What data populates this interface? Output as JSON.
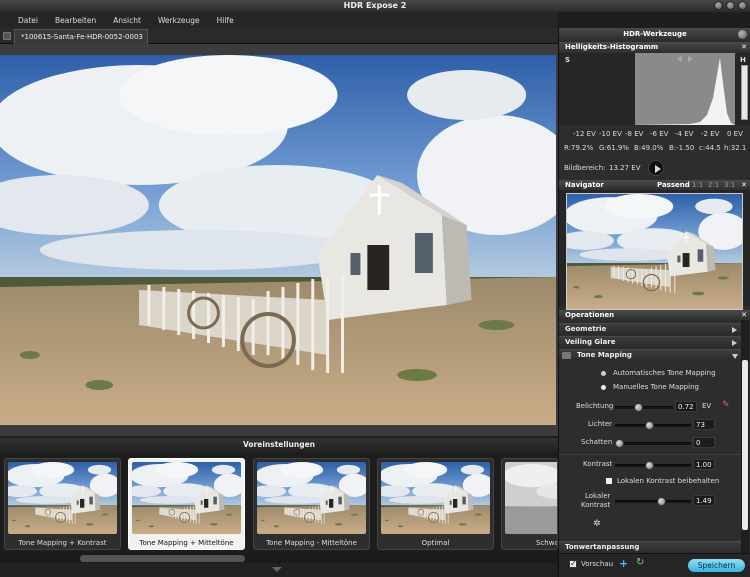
{
  "window": {
    "title": "HDR Expose 2"
  },
  "menu": [
    "Datei",
    "Bearbeiten",
    "Ansicht",
    "Werkzeuge",
    "Hilfe"
  ],
  "tab": {
    "title": "*100615-Santa-Fe-HDR-0052-0003"
  },
  "presets": {
    "header": "Voreinstellungen",
    "items": [
      {
        "label": "Tone Mapping + Kontrast"
      },
      {
        "label": "Tone Mapping + Mitteltöne",
        "selected": true
      },
      {
        "label": "Tone Mapping - Mitteltöne"
      },
      {
        "label": "Optimal"
      },
      {
        "label": "Schwa"
      }
    ]
  },
  "panel": {
    "title": "HDR-Werkzeuge",
    "histogram": {
      "title": "Helligkeits-Histogramm",
      "s_label": "S",
      "h_label": "H",
      "ticks": [
        "-12 EV",
        "-10 EV",
        "-8 EV",
        "-6 EV",
        "-4 EV",
        "-2 EV",
        "0 EV"
      ],
      "stats": {
        "r": "R:79.2%",
        "g": "G:61.9%",
        "b": "B:49.0%",
        "bval": "B:-1.50",
        "c": "c:44.5",
        "h": "h:32.1"
      },
      "range_label": "Bildbereich:",
      "range_value": "13.27 EV"
    },
    "navigator": {
      "title": "Navigator",
      "fit": "Passend",
      "z1": "1:1",
      "z2": "2:1",
      "z3": "3:1"
    },
    "operations": {
      "title": "Operationen",
      "sections": {
        "geometrie": "Geometrie",
        "veiling": "Veiling Glare",
        "tonemapping": "Tone Mapping",
        "tonwert": "Tonwertanpassung"
      },
      "mode_auto": "Automatisches Tone Mapping",
      "mode_manual": "Manuelles Tone Mapping",
      "exposure": {
        "label": "Belichtung",
        "value": "0.72",
        "unit": "EV",
        "level": 0.38
      },
      "lights": {
        "label": "Lichter",
        "value": "73",
        "level": 0.45
      },
      "shadows": {
        "label": "Schatten",
        "value": "0",
        "level": 0.0
      },
      "contrast": {
        "label": "Kontrast",
        "value": "1.00",
        "level": 0.45
      },
      "local_keep": "Lokalen Kontrast beibehalten",
      "local": {
        "label1": "Lokaler",
        "label2": "Kontrast",
        "value": "1.49",
        "level": 0.62
      }
    },
    "footer": {
      "preview_label": "Vorschau",
      "save_label": "Speichern"
    }
  },
  "colors": {
    "accent": "#5ec8ea",
    "selected_preset": "#f2f2f2"
  }
}
